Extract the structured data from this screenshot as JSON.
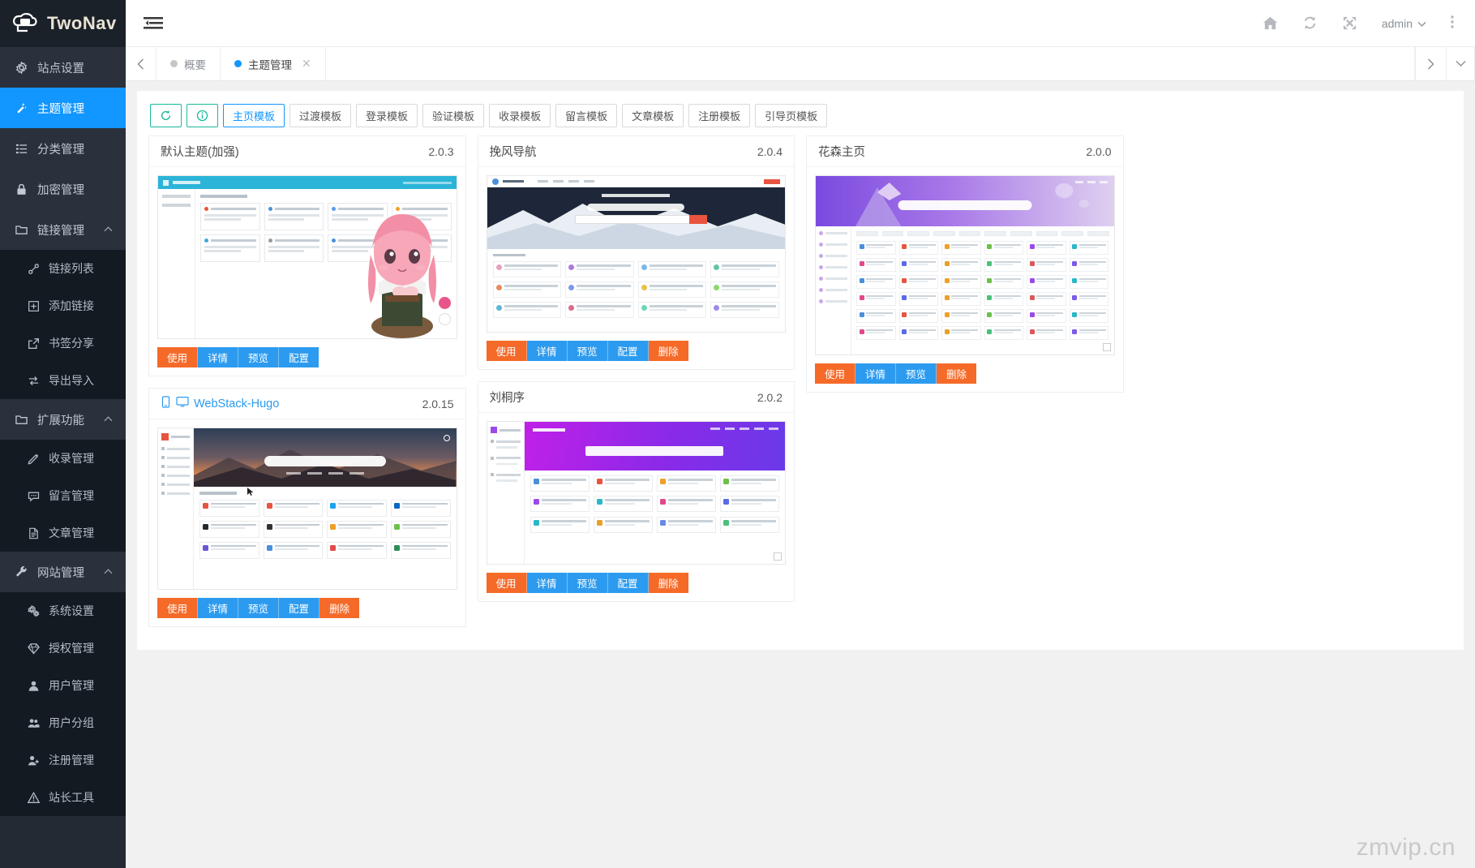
{
  "brand": {
    "title": "TwoNav",
    "logo_icon": "cloud-logo-icon"
  },
  "sidebar": {
    "items": [
      {
        "label": "站点设置",
        "icon": "gear-icon",
        "active": false,
        "children": []
      },
      {
        "label": "主题管理",
        "icon": "magic-wand-icon",
        "active": true,
        "children": []
      },
      {
        "label": "分类管理",
        "icon": "list-icon",
        "active": false,
        "children": []
      },
      {
        "label": "加密管理",
        "icon": "lock-icon",
        "active": false,
        "children": []
      },
      {
        "label": "链接管理",
        "icon": "folder-icon",
        "active": false,
        "caret": "chevron-up-icon",
        "children": [
          {
            "label": "链接列表",
            "icon": "link-icon"
          },
          {
            "label": "添加链接",
            "icon": "plus-square-icon"
          },
          {
            "label": "书签分享",
            "icon": "external-link-icon"
          },
          {
            "label": "导出导入",
            "icon": "exchange-icon"
          }
        ]
      },
      {
        "label": "扩展功能",
        "icon": "folder-icon",
        "active": false,
        "caret": "chevron-up-icon",
        "children": [
          {
            "label": "收录管理",
            "icon": "pencil-icon"
          },
          {
            "label": "留言管理",
            "icon": "comment-icon"
          },
          {
            "label": "文章管理",
            "icon": "file-text-icon"
          }
        ]
      },
      {
        "label": "网站管理",
        "icon": "wrench-icon",
        "active": false,
        "caret": "chevron-up-icon",
        "children": [
          {
            "label": "系统设置",
            "icon": "cogs-icon"
          },
          {
            "label": "授权管理",
            "icon": "diamond-icon"
          },
          {
            "label": "用户管理",
            "icon": "user-icon"
          },
          {
            "label": "用户分组",
            "icon": "users-icon"
          },
          {
            "label": "注册管理",
            "icon": "user-plus-icon"
          },
          {
            "label": "站长工具",
            "icon": "warning-triangle-icon"
          }
        ]
      }
    ]
  },
  "topbar": {
    "menu_toggle_icon": "hamburger-icon",
    "icons": [
      {
        "name": "home-icon"
      },
      {
        "name": "refresh-icon"
      },
      {
        "name": "fullscreen-icon"
      }
    ],
    "user": "admin",
    "user_caret_icon": "chevron-down-icon",
    "more_icon": "vertical-dots-icon"
  },
  "tabstrip": {
    "left_arrow_icon": "chevron-left-icon",
    "right_arrow_icon": "chevron-right-icon",
    "dropdown_icon": "chevron-down-icon",
    "tabs": [
      {
        "label": "概要",
        "active": false,
        "closable": false
      },
      {
        "label": "主题管理",
        "active": true,
        "closable": true,
        "close_icon": "close-icon"
      }
    ]
  },
  "toolbar": {
    "refresh_icon": "refresh-circle-icon",
    "info_icon": "info-circle-icon",
    "filters": [
      {
        "label": "主页模板",
        "active": true
      },
      {
        "label": "过渡模板",
        "active": false
      },
      {
        "label": "登录模板",
        "active": false
      },
      {
        "label": "验证模板",
        "active": false
      },
      {
        "label": "收录模板",
        "active": false
      },
      {
        "label": "留言模板",
        "active": false
      },
      {
        "label": "文章模板",
        "active": false
      },
      {
        "label": "注册模板",
        "active": false
      },
      {
        "label": "引导页模板",
        "active": false
      }
    ]
  },
  "themes": [
    {
      "name": "默认主题(加强)",
      "version": "2.0.3",
      "is_link": false,
      "device_icons": [],
      "preview": "default-theme-preview",
      "actions": [
        {
          "label": "使用",
          "style": "orange"
        },
        {
          "label": "详情",
          "style": "blue"
        },
        {
          "label": "预览",
          "style": "blue"
        },
        {
          "label": "配置",
          "style": "blue"
        }
      ]
    },
    {
      "name": "WebStack-Hugo",
      "version": "2.0.15",
      "is_link": true,
      "device_icons": [
        "mobile-icon",
        "desktop-icon"
      ],
      "preview": "webstack-hugo-preview",
      "actions": [
        {
          "label": "使用",
          "style": "orange"
        },
        {
          "label": "详情",
          "style": "blue"
        },
        {
          "label": "预览",
          "style": "blue"
        },
        {
          "label": "配置",
          "style": "blue"
        },
        {
          "label": "删除",
          "style": "orange"
        }
      ]
    },
    {
      "name": "挽风导航",
      "version": "2.0.4",
      "is_link": false,
      "device_icons": [],
      "preview": "wanfeng-nav-preview",
      "actions": [
        {
          "label": "使用",
          "style": "orange"
        },
        {
          "label": "详情",
          "style": "blue"
        },
        {
          "label": "预览",
          "style": "blue"
        },
        {
          "label": "配置",
          "style": "blue"
        },
        {
          "label": "删除",
          "style": "orange"
        }
      ]
    },
    {
      "name": "刘桐序",
      "version": "2.0.2",
      "is_link": false,
      "device_icons": [],
      "preview": "liutongxu-preview",
      "actions": [
        {
          "label": "使用",
          "style": "orange"
        },
        {
          "label": "详情",
          "style": "blue"
        },
        {
          "label": "预览",
          "style": "blue"
        },
        {
          "label": "配置",
          "style": "blue"
        },
        {
          "label": "删除",
          "style": "orange"
        }
      ]
    },
    {
      "name": "花森主页",
      "version": "2.0.0",
      "is_link": false,
      "device_icons": [],
      "preview": "huasen-home-preview",
      "actions": [
        {
          "label": "使用",
          "style": "orange"
        },
        {
          "label": "详情",
          "style": "blue"
        },
        {
          "label": "预览",
          "style": "blue"
        },
        {
          "label": "删除",
          "style": "orange"
        }
      ]
    }
  ],
  "watermark": "zmvip.cn",
  "colors": {
    "sidebar_bg": "#232a34",
    "sidebar_sub_bg": "#141a22",
    "accent_blue": "#1296ff",
    "btn_orange": "#f56a28",
    "btn_blue": "#2c9bef",
    "toolbar_green": "#1aba9c"
  }
}
